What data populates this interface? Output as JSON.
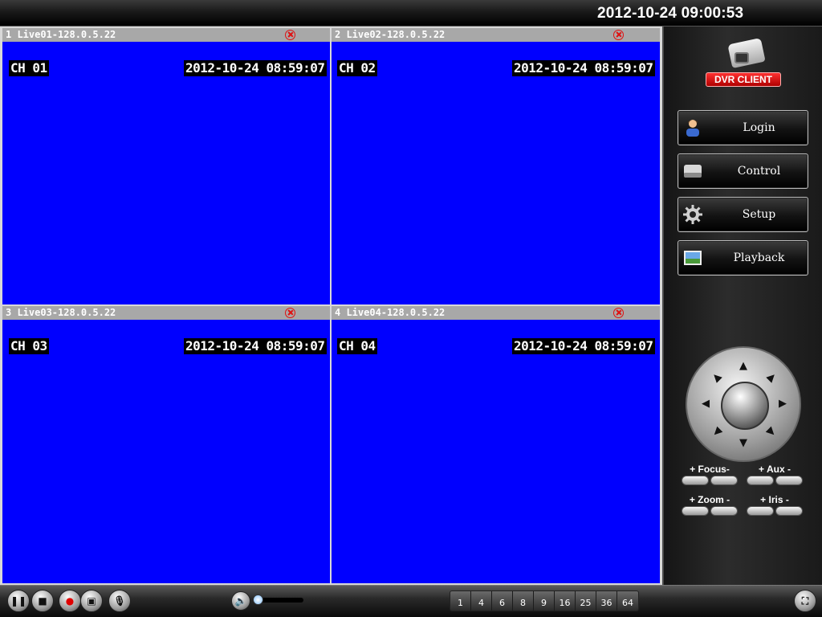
{
  "header": {
    "datetime": "2012-10-24 09:00:53"
  },
  "panes": [
    {
      "title": "1 Live01-128.0.5.22",
      "channel": "CH 01",
      "timestamp": "2012-10-24 08:59:07"
    },
    {
      "title": "2 Live02-128.0.5.22",
      "channel": "CH 02",
      "timestamp": "2012-10-24 08:59:07"
    },
    {
      "title": "3 Live03-128.0.5.22",
      "channel": "CH 03",
      "timestamp": "2012-10-24 08:59:07"
    },
    {
      "title": "4 Live04-128.0.5.22",
      "channel": "CH 04",
      "timestamp": "2012-10-24 08:59:07"
    }
  ],
  "colors": {
    "video_bg": "#0000ff",
    "title_bar": "#a8a8a8",
    "close_icon": "#e01010",
    "logo_badge": "#d00000"
  },
  "sidebar": {
    "logo_text": "DVR CLIENT",
    "buttons": [
      {
        "label": "Login",
        "icon": "user-icon"
      },
      {
        "label": "Control",
        "icon": "device-icon"
      },
      {
        "label": "Setup",
        "icon": "gear-icon"
      },
      {
        "label": "Playback",
        "icon": "picture-icon"
      }
    ],
    "ptz": {
      "focus_label": "+ Focus-",
      "aux_label": "+ Aux  -",
      "zoom_label": "+ Zoom -",
      "iris_label": "+ Iris -"
    }
  },
  "toolbar": {
    "buttons": [
      "pause-icon",
      "stop-icon",
      "record-icon",
      "capture-icon",
      "talk-icon"
    ],
    "volume_level": 0.08,
    "split_options": [
      "1",
      "4",
      "6",
      "8",
      "9",
      "16",
      "25",
      "36",
      "64"
    ],
    "fullscreen_icon": "fullscreen-icon"
  }
}
